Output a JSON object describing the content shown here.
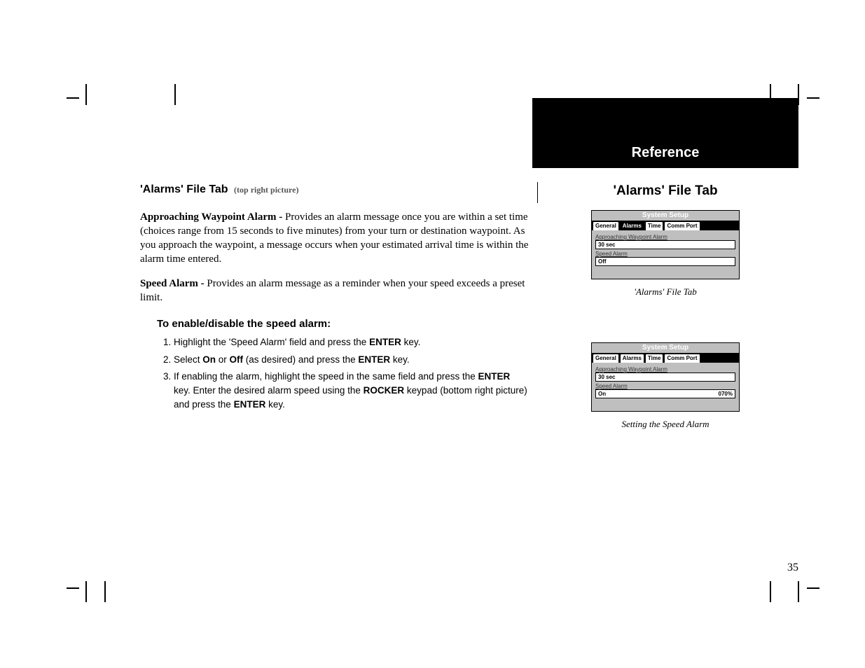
{
  "header": {
    "section": "Reference",
    "side_title": "'Alarms' File Tab"
  },
  "main": {
    "title": "'Alarms' File Tab",
    "title_sub": "(top right picture)",
    "para1_lead": "Approaching Waypoint Alarm - ",
    "para1_body": "Provides an alarm message once you are within a set time (choices range from 15 seconds to five minutes) from your turn or destination waypoint.  As you approach the waypoint, a message occurs when your estimated arrival time is within the alarm time entered.",
    "para2_lead": "Speed Alarm - ",
    "para2_body": "Provides an alarm message as a reminder when your speed exceeds a preset limit.",
    "instr_head": "To enable/disable the speed alarm:",
    "steps": {
      "s1_a": "Highlight the 'Speed Alarm' field and press the ",
      "s1_b": "ENTER",
      "s1_c": " key.",
      "s2_a": "Select ",
      "s2_b": "On",
      "s2_c": " or ",
      "s2_d": "Off",
      "s2_e": " (as desired) and press the ",
      "s2_f": "ENTER",
      "s2_g": " key.",
      "s3_a": "If enabling the alarm, highlight the speed in the same field and press the ",
      "s3_b": "ENTER",
      "s3_c": " key.  Enter the desired alarm speed using the ",
      "s3_d": "ROCKER",
      "s3_e": " keypad (bottom right picture) and press the ",
      "s3_f": "ENTER",
      "s3_g": " key."
    }
  },
  "screens": {
    "tabs": {
      "t1": "General",
      "t2": "Alarms",
      "t3": "Time",
      "t4": "Comm Port"
    },
    "titlebar": "System Setup",
    "field1_label": "Approaching Waypoint Alarm",
    "field2_label": "Speed Alarm",
    "top": {
      "field1_value": "30 sec",
      "field2_value": "Off",
      "caption": "'Alarms' File Tab"
    },
    "bottom": {
      "field1_value": "30 sec",
      "field2_value_left": "On",
      "field2_value_right": "070%",
      "caption": "Setting the Speed Alarm"
    }
  },
  "page_number": "35"
}
